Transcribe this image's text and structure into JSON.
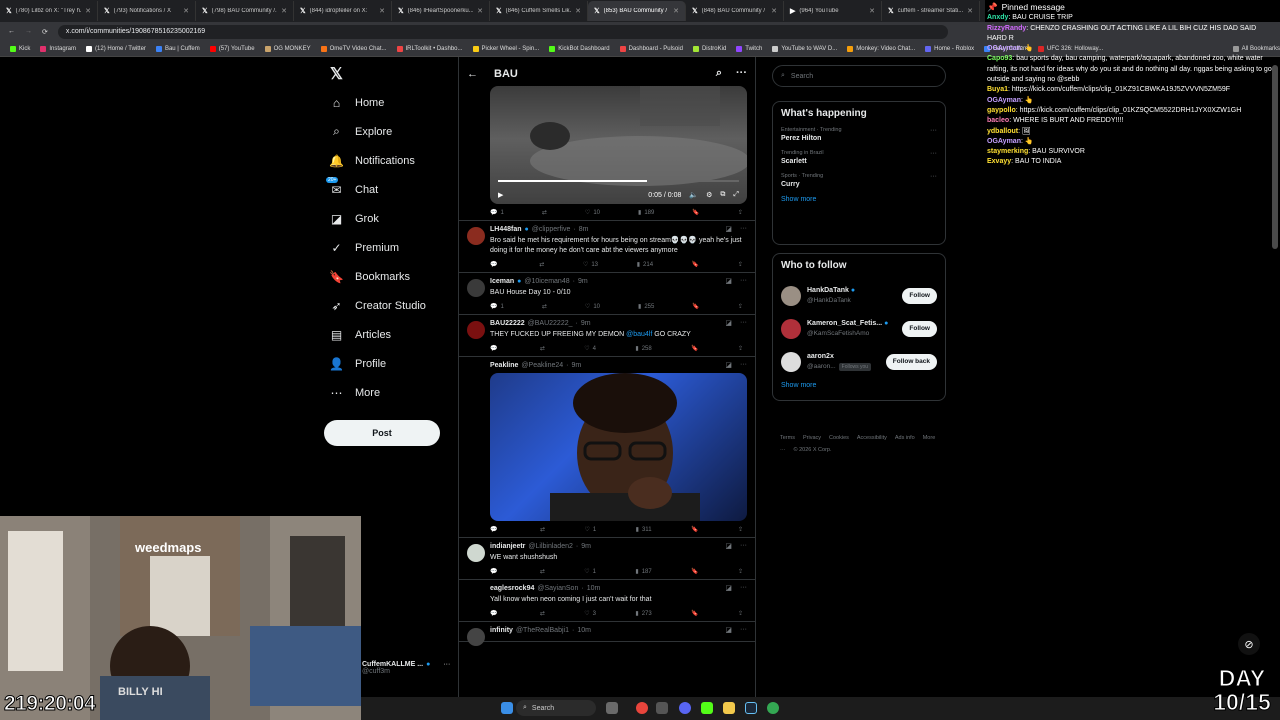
{
  "browser": {
    "tabs": [
      {
        "label": "(780) Lilbz on X: \"Trey h...",
        "active": false
      },
      {
        "label": "(793) Notifications / X",
        "active": false
      },
      {
        "label": "(798) BAU Community /...",
        "active": false
      },
      {
        "label": "(844) idropfeiler on X:",
        "active": false
      },
      {
        "label": "(846) IHeartSpoonerku...",
        "active": false
      },
      {
        "label": "(846) Cuffem Smells Lik...",
        "active": false
      },
      {
        "label": "(853) BAU Community /",
        "active": true
      },
      {
        "label": "(848) BAU Community /",
        "active": false
      },
      {
        "label": "(964) YouTube",
        "active": false
      },
      {
        "label": "cuffem - streamer Stati...",
        "active": false
      }
    ],
    "url": "x.com/i/communities/1908678516235002169",
    "bookmarks": [
      {
        "label": "Kick",
        "color": "#53fc18"
      },
      {
        "label": "Instagram",
        "color": "#e1306c"
      },
      {
        "label": "(12) Home / Twitter",
        "color": "#ffffff"
      },
      {
        "label": "Bau | Cuffem",
        "color": "#3b82f6"
      },
      {
        "label": "(57) YouTube",
        "color": "#ff0000"
      },
      {
        "label": "OG MONKEY",
        "color": "#c9a36b"
      },
      {
        "label": "OmeTV Video Chat...",
        "color": "#f97316"
      },
      {
        "label": "IRLToolkit • Dashbo...",
        "color": "#ef4444"
      },
      {
        "label": "Picker Wheel - Spin...",
        "color": "#facc15"
      },
      {
        "label": "KickBot Dashboard",
        "color": "#53fc18"
      },
      {
        "label": "Dashboard - Pulsoid",
        "color": "#ef4444"
      },
      {
        "label": "DistroKid",
        "color": "#a3e635"
      },
      {
        "label": "Twitch",
        "color": "#9146ff"
      },
      {
        "label": "YouTube to WAV D...",
        "color": "#cccccc"
      },
      {
        "label": "Monkey: Video Chat...",
        "color": "#f59e0b"
      },
      {
        "label": "Home - Roblox",
        "color": "#6366f1"
      },
      {
        "label": "Bau | Cuffem",
        "color": "#3b82f6"
      },
      {
        "label": "UFC 326: Holloway...",
        "color": "#dc2626"
      },
      {
        "label": "All Bookmarks",
        "color": "#999999"
      }
    ]
  },
  "nav": {
    "items": [
      {
        "label": "Home",
        "icon": "home-icon"
      },
      {
        "label": "Explore",
        "icon": "search-icon"
      },
      {
        "label": "Notifications",
        "icon": "bell-icon"
      },
      {
        "label": "Chat",
        "icon": "chat-icon",
        "badge": "20+"
      },
      {
        "label": "Grok",
        "icon": "grok-icon"
      },
      {
        "label": "Premium",
        "icon": "premium-icon"
      },
      {
        "label": "Bookmarks",
        "icon": "bookmark-icon"
      },
      {
        "label": "Creator Studio",
        "icon": "rocket-icon"
      },
      {
        "label": "Articles",
        "icon": "article-icon"
      },
      {
        "label": "Profile",
        "icon": "person-icon"
      },
      {
        "label": "More",
        "icon": "more-icon"
      }
    ],
    "post_label": "Post",
    "profile_name": "CuffemKALLME ...",
    "profile_handle": "@cuff3m"
  },
  "community": {
    "title": "BAU",
    "video_time": "0:05 / 0:08",
    "video_actions": {
      "replies": "1",
      "likes": "10",
      "views": "189"
    },
    "tweets": [
      {
        "name": "LH448fan",
        "verified": true,
        "handle": "@clipperfive",
        "time": "8m",
        "text": "Bro said he met his requirement for hours being on stream💀💀💀 yeah he's just doing it for the money he don't care abt the viewers anymore",
        "replies": "",
        "likes": "13",
        "views": "214",
        "avatar": "#8b2c1f"
      },
      {
        "name": "Iceman",
        "verified": true,
        "handle": "@10iceman48",
        "time": "9m",
        "text": "BAU House Day 10 - 0/10",
        "replies": "1",
        "likes": "10",
        "views": "255",
        "avatar": "#3a3a3a"
      },
      {
        "name": "BAU22222",
        "verified": false,
        "handle": "@BAU22222_",
        "time": "9m",
        "text_pre": "THEY FUCKED UP FREEING MY DEMON ",
        "mention": "@bau4lf",
        "text_post": " GO CRAZY",
        "replies": "",
        "likes": "4",
        "views": "258",
        "avatar": "#7a1010"
      },
      {
        "name": "Peakline",
        "verified": false,
        "handle": "@Peakline24",
        "time": "9m",
        "text": "",
        "replies": "",
        "likes": "1",
        "views": "311",
        "avatar": "#000000"
      },
      {
        "name": "indianjeetr",
        "verified": false,
        "handle": "@Lilbinladen2",
        "time": "9m",
        "text": "WE want shushshush",
        "replies": "",
        "likes": "1",
        "views": "187",
        "avatar": "#cfd8d0"
      },
      {
        "name": "eaglesrock94",
        "verified": false,
        "handle": "@SayianSon",
        "time": "10m",
        "text": "Yall know when neon coming I just can't wait for that",
        "replies": "",
        "likes": "3",
        "views": "273",
        "avatar": "#000000"
      },
      {
        "name": "infinity",
        "verified": false,
        "handle": "@TheRealBabji1",
        "time": "10m",
        "text": "",
        "replies": "",
        "likes": "",
        "views": "",
        "avatar": "#444444"
      }
    ]
  },
  "right": {
    "search_placeholder": "Search",
    "happening_title": "What's happening",
    "trends": [
      {
        "context": "Entertainment · Trending",
        "name": "Perez Hilton"
      },
      {
        "context": "Trending in Brazil",
        "name": "Scarlett"
      },
      {
        "context": "Sports · Trending",
        "name": "Curry"
      }
    ],
    "show_more": "Show more",
    "who_title": "Who to follow",
    "follow": [
      {
        "name": "HankDaTank",
        "handle": "@HankDaTank",
        "button": "Follow",
        "verified": true,
        "avatar": "#9a8f84"
      },
      {
        "name": "Kameron_Scat_Fetis...",
        "handle": "@KamScaFetishAmo",
        "button": "Follow",
        "verified": true,
        "avatar": "#b0303a"
      },
      {
        "name": "aaron2x",
        "handle": "@aaron...",
        "button": "Follow back",
        "verified": false,
        "follows_you": "Follows you",
        "avatar": "#dddddd"
      }
    ],
    "footer": [
      "Terms",
      "Privacy",
      "Cookies",
      "Accessibility",
      "Ads info",
      "More ···",
      "© 2026 X Corp."
    ]
  },
  "chat": {
    "pinned_label": "Pinned message",
    "lines": [
      {
        "user": "Anxdy",
        "color": "#2ee6a8",
        "text": "BAU CRUISE TRIP"
      },
      {
        "user": "RizzyRandy",
        "color": "#d36bff",
        "text": "CHENZO CRASHING OUT ACTING LIKE A LIL BIH CUZ HIS DAD SAID HARD R"
      },
      {
        "user": "OGAyman",
        "color": "#c4a0ff",
        "text": "👆"
      },
      {
        "user": "Capo93",
        "color": "#7cfc62",
        "text": "bau sports day, bau camping, waterpark/aquapark, abandoned zoo, white water rafting, its not hard for ideas why do you sit and do nothing all day. nggas being asking to go outside and saying no @sebb"
      },
      {
        "user": "Buya1",
        "color": "#ffe033",
        "text": "https://kick.com/cuffem/clips/clip_01KZ91CBWKA19J5ZVVVN5ZM59F"
      },
      {
        "user": "OGAyman",
        "color": "#c4a0ff",
        "text": "👆"
      },
      {
        "user": "gaypollo",
        "color": "#ffe033",
        "text": "https://kick.com/cuffem/clips/clip_01KZ9QCM5522DRH1JYX0XZW1GH"
      },
      {
        "user": "bacleo",
        "color": "#ff7eb6",
        "text": "WHERE IS BURT AND FREDDY!!!!"
      },
      {
        "user": "ydballout",
        "color": "#ffe033",
        "text": "🖼"
      },
      {
        "user": "OGAyman",
        "color": "#c4a0ff",
        "text": "👆"
      },
      {
        "user": "staymerking",
        "color": "#ffe033",
        "text": "BAU SURVIVOR"
      },
      {
        "user": "Exvayy",
        "color": "#ffe033",
        "text": "BAU TO INDIA"
      }
    ]
  },
  "stream": {
    "timer": "219:20:04",
    "day_label": "DAY",
    "day_count": "10/15",
    "webcam_text": "weedmaps",
    "shirt_text": "BILLY HI"
  },
  "taskbar": {
    "search_label": "Search"
  }
}
